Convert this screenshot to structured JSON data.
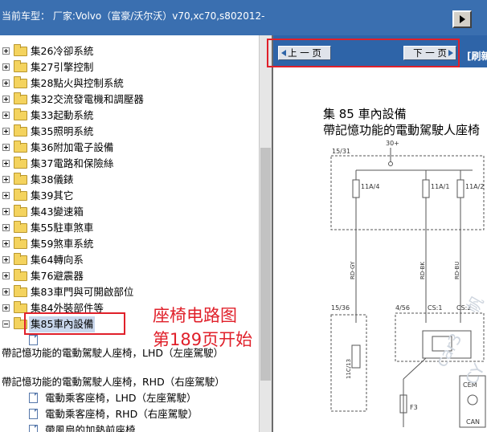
{
  "header": {
    "title": "当前车型：  厂家:Volvo（富豪/沃尔沃）v70,xc70,s802012-"
  },
  "tree": {
    "folders": [
      {
        "label": "集26冷卻系統"
      },
      {
        "label": "集27引擎控制"
      },
      {
        "label": "集28點火與控制系統"
      },
      {
        "label": "集32交流發電機和調壓器"
      },
      {
        "label": "集33起動系統"
      },
      {
        "label": "集35照明系統"
      },
      {
        "label": "集36附加電子設備"
      },
      {
        "label": "集37電路和保險絲"
      },
      {
        "label": "集38儀錶"
      },
      {
        "label": "集39其它"
      },
      {
        "label": "集43變速箱"
      },
      {
        "label": "集55駐車煞車"
      },
      {
        "label": "集59煞車系統"
      },
      {
        "label": "集64轉向系"
      },
      {
        "label": "集76避震器"
      },
      {
        "label": "集83車門與可開啟部位"
      },
      {
        "label": "集84外裝部件等"
      }
    ],
    "selected_label": "集85車內設備",
    "groups": [
      {
        "label": "帶記憶功能的電動駕駛人座椅，LHD（左座駕駛）"
      },
      {
        "label": "帶記憶功能的電動駕駛人座椅，RHD（右座駕駛）"
      }
    ],
    "leaves": [
      {
        "label": "電動乘客座椅，LHD（左座駕駛）"
      },
      {
        "label": "電動乘客座椅，RHD（右座駕駛）"
      },
      {
        "label": "帶風扇的加熱前座椅"
      }
    ]
  },
  "annotation": {
    "line1": "座椅电路图",
    "line2": "第189页开始",
    "color": "#e0202a"
  },
  "viewer": {
    "prev_label": "上 一 页",
    "next_label": "下 一 页",
    "refresh_label": "[刷新",
    "doc_title": "集 85 車內設備",
    "doc_subtitle": "帶記憶功能的電動駕駛人座椅",
    "diagram": {
      "supply_label": "30+",
      "connector_top": "15/31",
      "fuses": [
        "11A/4",
        "11A/1",
        "11A/2"
      ],
      "wires": [
        "RD-GY",
        "RD-BK",
        "RD-BU"
      ],
      "connector_left": "15/36",
      "connector_mid": "4/56",
      "cs_labels": [
        "CS:1",
        "CS:2"
      ],
      "fuse_lower": "11C/13",
      "fuse_f3": "F3",
      "module": "CEM",
      "can_label": "CAN"
    },
    "watermarks": [
      "帆",
      "car3",
      "CY"
    ]
  },
  "colors": {
    "titlebar": "#3a6fb0",
    "toolbar": "#2e64a8",
    "selection": "#c9d7ec"
  }
}
